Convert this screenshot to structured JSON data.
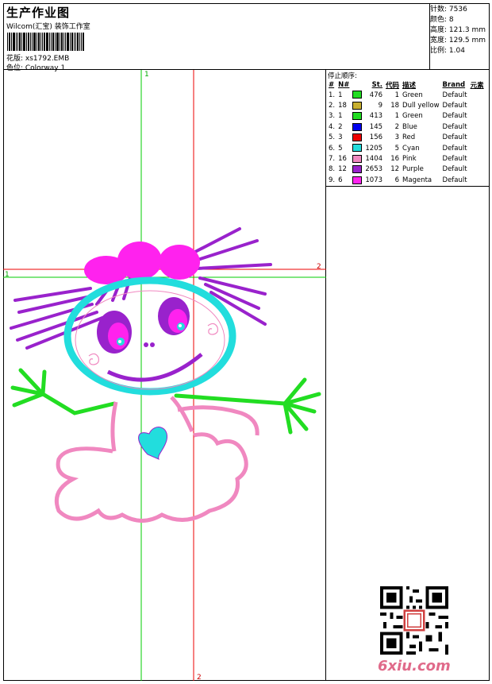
{
  "header": {
    "title": "生产作业图",
    "company": "Wilcom(汇宝) 装饰工作室",
    "design": "花版: xs1792.EMB",
    "colorway": "色位: Colorway 1"
  },
  "info": {
    "stitches": "针数: 7536",
    "colors": "颜色: 8",
    "height": "高度: 121.3 mm",
    "width": "宽度: 129.5 mm",
    "scale": "比例: 1.04"
  },
  "guides": {
    "v1": "1",
    "v2": "2",
    "h1": "1",
    "h2": "2"
  },
  "sequence": {
    "title": "停止顺序:",
    "headers": [
      "#",
      "N#",
      "",
      "St.",
      "代码",
      "描述",
      "Brand",
      "元素"
    ],
    "rows": [
      {
        "idx": "1.",
        "n": "1",
        "color": "#22dd22",
        "st": "476",
        "code": "1",
        "desc": "Green",
        "brand": "Default"
      },
      {
        "idx": "2.",
        "n": "18",
        "color": "#c8b030",
        "st": "9",
        "code": "18",
        "desc": "Dull yellow",
        "brand": "Default"
      },
      {
        "idx": "3.",
        "n": "1",
        "color": "#22dd22",
        "st": "413",
        "code": "1",
        "desc": "Green",
        "brand": "Default"
      },
      {
        "idx": "4.",
        "n": "2",
        "color": "#0000ee",
        "st": "145",
        "code": "2",
        "desc": "Blue",
        "brand": "Default"
      },
      {
        "idx": "5.",
        "n": "3",
        "color": "#ee0000",
        "st": "156",
        "code": "3",
        "desc": "Red",
        "brand": "Default"
      },
      {
        "idx": "6.",
        "n": "5",
        "color": "#22dddd",
        "st": "1205",
        "code": "5",
        "desc": "Cyan",
        "brand": "Default"
      },
      {
        "idx": "7.",
        "n": "16",
        "color": "#f088c0",
        "st": "1404",
        "code": "16",
        "desc": "Pink",
        "brand": "Default"
      },
      {
        "idx": "8.",
        "n": "12",
        "color": "#9922cc",
        "st": "2653",
        "code": "12",
        "desc": "Purple",
        "brand": "Default"
      },
      {
        "idx": "9.",
        "n": "6",
        "color": "#ff22ee",
        "st": "1073",
        "code": "6",
        "desc": "Magenta",
        "brand": "Default"
      }
    ]
  },
  "watermark": "6xiu.com"
}
